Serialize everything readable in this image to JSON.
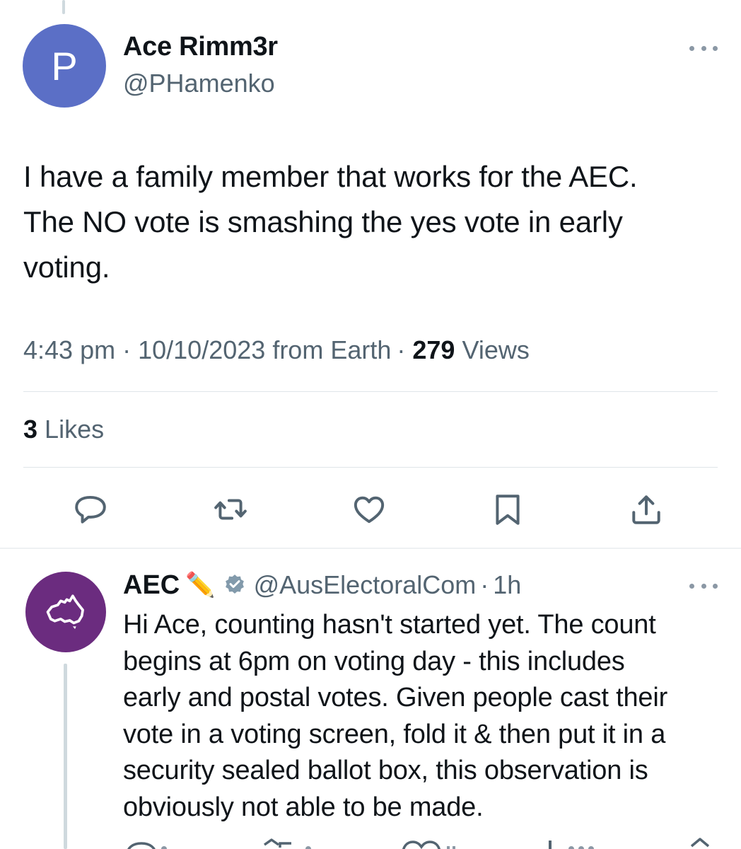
{
  "tweet": {
    "avatar_letter": "P",
    "display_name": "Ace Rimm3r",
    "handle": "@PHamenko",
    "text": "I have a family member that works for the AEC.\nThe NO vote is smashing the yes vote in early\nvoting.",
    "time": "4:43 pm",
    "date": "10/10/2023",
    "source": "from Earth",
    "sep": "·",
    "views_count": "279",
    "views_label": "Views",
    "likes_count": "3",
    "likes_label": "Likes"
  },
  "reply": {
    "display_name": "AEC",
    "emoji": "✏️",
    "handle": "@AusElectoralCom",
    "sep": "·",
    "time": "1h",
    "text": "Hi Ace, counting hasn't started yet. The count\nbegins at 6pm on voting day - this includes\nearly and postal votes. Given people cast their\nvote in a voting screen, fold it & then put it in a\nsecurity sealed ballot box, this observation is\nobviously not able to be made."
  },
  "icons": {
    "more": "more-icon",
    "reply": "reply-icon",
    "retweet": "retweet-icon",
    "like": "heart-icon",
    "bookmark": "bookmark-icon",
    "share": "share-icon",
    "verified": "verified-badge-icon",
    "aec_logo": "australia-map-logo"
  },
  "colors": {
    "avatar_main": "#5b6fc6",
    "avatar_aec": "#6b2c7f",
    "secondary_text": "#536471",
    "icon": "#536471"
  }
}
